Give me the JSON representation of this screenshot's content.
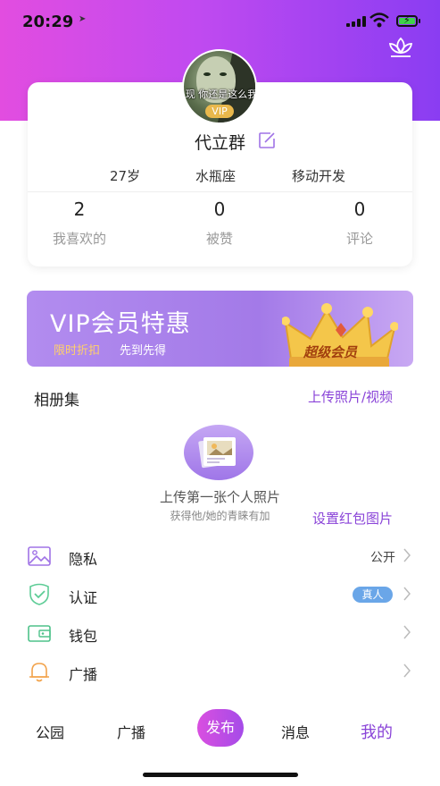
{
  "status": {
    "time": "20:29"
  },
  "profile": {
    "avatar_caption": "现 你还是这么我",
    "vip_badge": "VIP",
    "name": "代立群",
    "age": "27岁",
    "zodiac": "水瓶座",
    "job": "移动开发",
    "stats": [
      {
        "value": "2",
        "label": "我喜欢的"
      },
      {
        "value": "0",
        "label": "被赞"
      },
      {
        "value": "0",
        "label": "评论"
      }
    ]
  },
  "vip_banner": {
    "title": "VIP会员特惠",
    "tag1": "限时折扣",
    "tag2": "先到先得",
    "crown_text": "超级会员"
  },
  "album": {
    "title": "相册集",
    "upload_link": "上传照片/视频",
    "empty_title": "上传第一张个人照片",
    "empty_sub": "获得他/她的青睐有加",
    "redpack_link": "设置红包图片"
  },
  "menu": [
    {
      "label": "隐私",
      "value": "公开",
      "icon": "image-icon"
    },
    {
      "label": "认证",
      "tag": "真人",
      "icon": "shield-check-icon"
    },
    {
      "label": "钱包",
      "icon": "wallet-icon"
    },
    {
      "label": "广播",
      "icon": "bell-icon"
    }
  ],
  "tabs": {
    "park": "公园",
    "broadcast": "广播",
    "publish": "发布",
    "messages": "消息",
    "mine": "我的"
  },
  "colors": {
    "accent": "#8a44d8",
    "gradient_start": "#e24de0",
    "gradient_end": "#8a3df2",
    "vip_gold": "#e9b84c",
    "verified_tag": "#6aa6e8"
  }
}
